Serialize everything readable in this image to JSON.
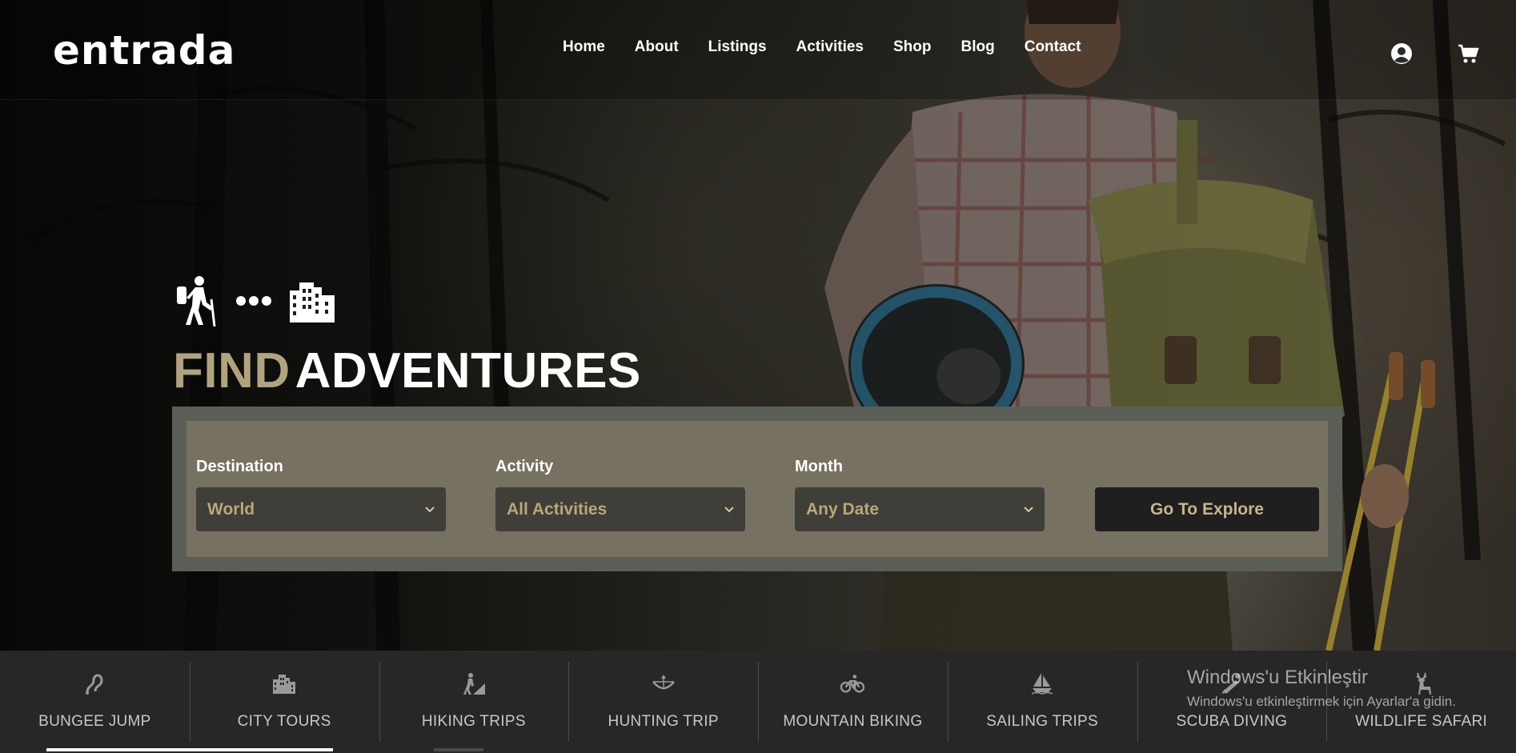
{
  "brand": {
    "logo_text": "entrada"
  },
  "nav": {
    "items": [
      {
        "label": "Home"
      },
      {
        "label": "About"
      },
      {
        "label": "Listings"
      },
      {
        "label": "Activities"
      },
      {
        "label": "Shop"
      },
      {
        "label": "Blog"
      },
      {
        "label": "Contact"
      }
    ],
    "account_icon": "user-circle-icon",
    "cart_icon": "cart-icon"
  },
  "hero": {
    "icons": [
      "hiker-icon",
      "dots-icon",
      "city-icon"
    ],
    "headline_accent": "FIND",
    "headline_main": "ADVENTURES",
    "accent_color": "#b0a37e"
  },
  "search": {
    "destination": {
      "label": "Destination",
      "value": "World"
    },
    "activity": {
      "label": "Activity",
      "value": "All Activities"
    },
    "month": {
      "label": "Month",
      "value": "Any Date"
    },
    "submit_label": "Go To Explore"
  },
  "categories": [
    {
      "label": "BUNGEE JUMP",
      "icon": "bungee-icon"
    },
    {
      "label": "CITY TOURS",
      "icon": "city-icon"
    },
    {
      "label": "HIKING TRIPS",
      "icon": "hiking-icon"
    },
    {
      "label": "HUNTING TRIP",
      "icon": "hunting-icon"
    },
    {
      "label": "MOUNTAIN BIKING",
      "icon": "bicycle-icon"
    },
    {
      "label": "SAILING TRIPS",
      "icon": "sailboat-icon"
    },
    {
      "label": "SCUBA DIVING",
      "icon": "scuba-icon"
    },
    {
      "label": "WILDLIFE SAFARI",
      "icon": "deer-icon"
    }
  ],
  "watermark": {
    "title": "Windows'u Etkinleştir",
    "subtitle": "Windows'u etkinleştirmek için Ayarlar'a gidin."
  }
}
